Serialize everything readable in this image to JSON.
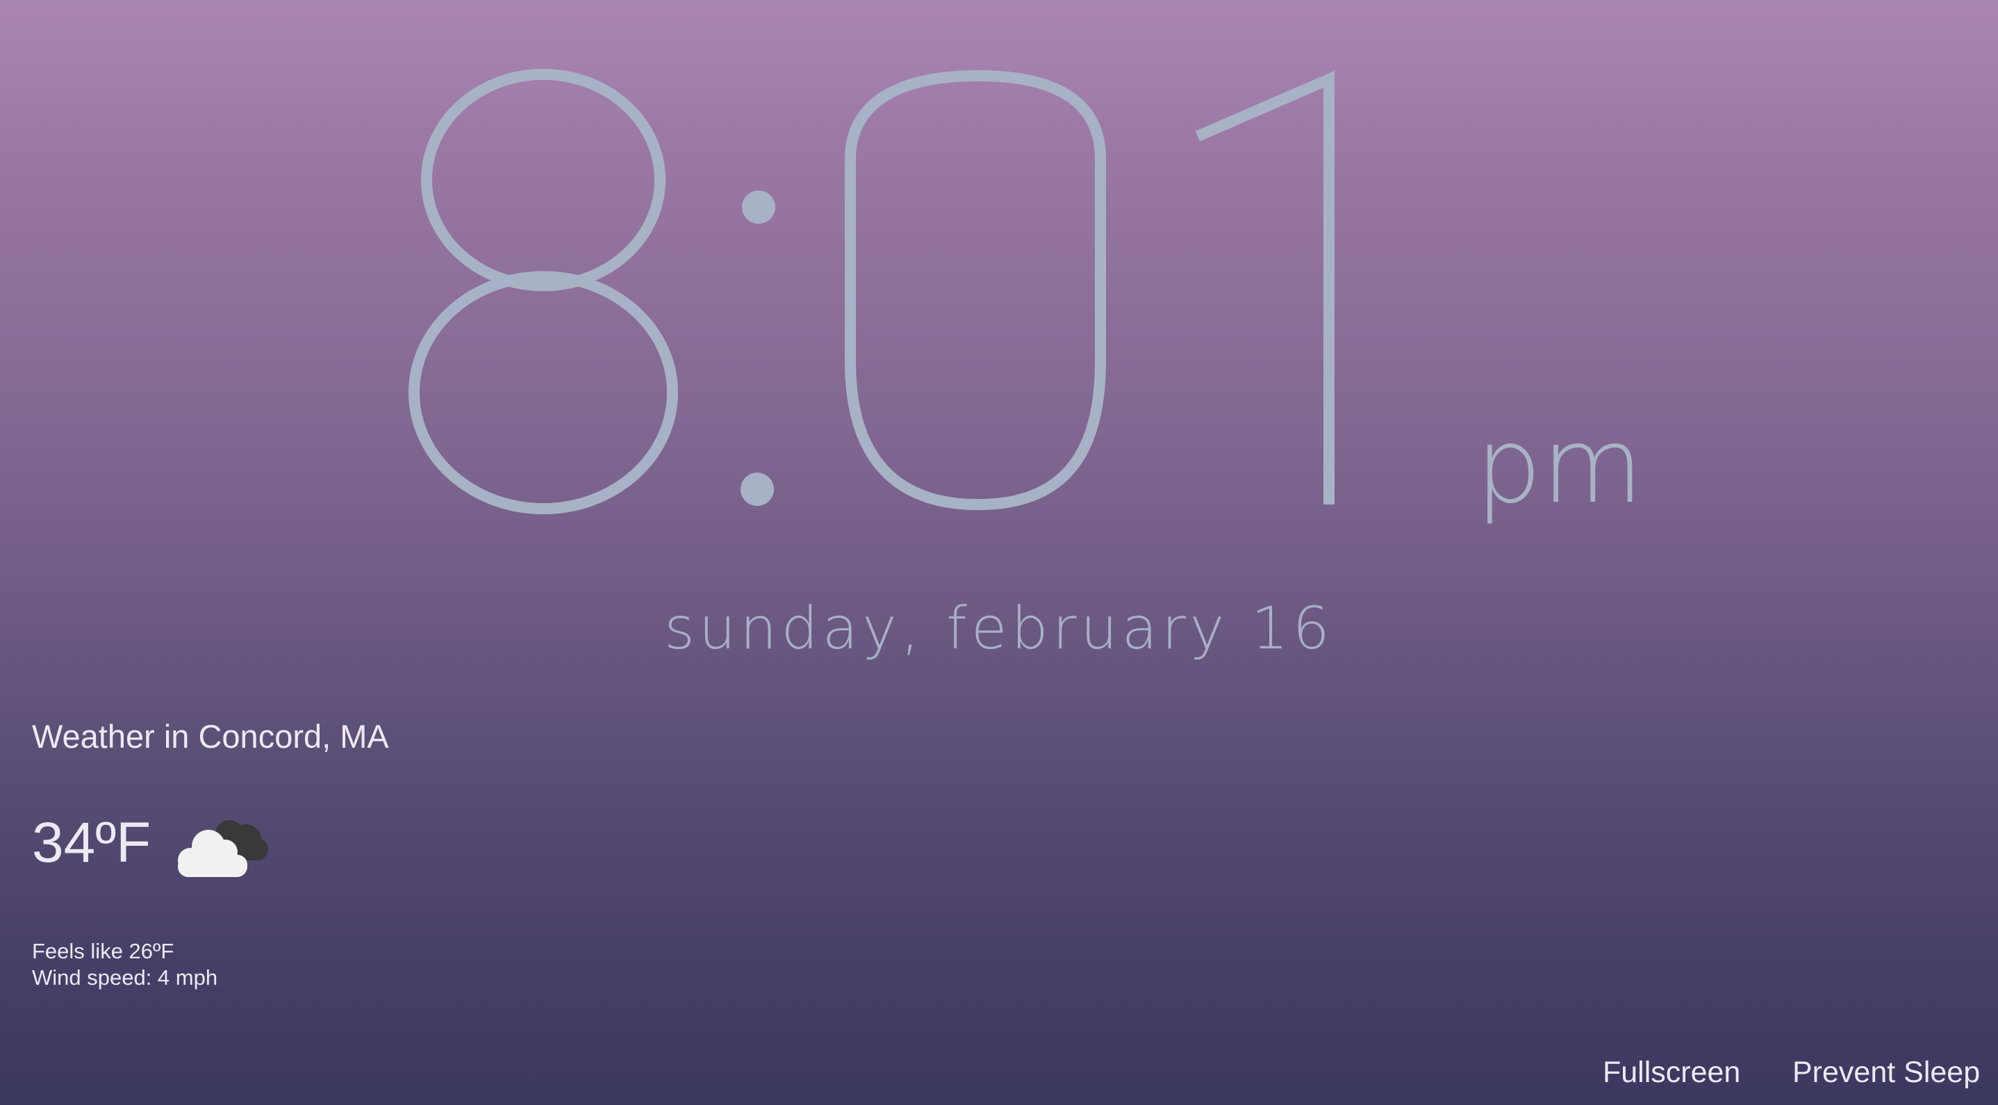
{
  "clock": {
    "hour": "8",
    "separator": ":",
    "minute_tens": "0",
    "minute_ones": "1",
    "meridiem": "pm",
    "color": "#a8b2c6"
  },
  "date": "sunday, february 16",
  "weather": {
    "title": "Weather in Concord, MA",
    "temperature": "34ºF",
    "condition_icon": "cloud-icon",
    "feels_like": "Feels like 26ºF",
    "wind_speed": "Wind speed: 4 mph"
  },
  "controls": {
    "fullscreen_label": "Fullscreen",
    "prevent_sleep_label": "Prevent Sleep"
  }
}
